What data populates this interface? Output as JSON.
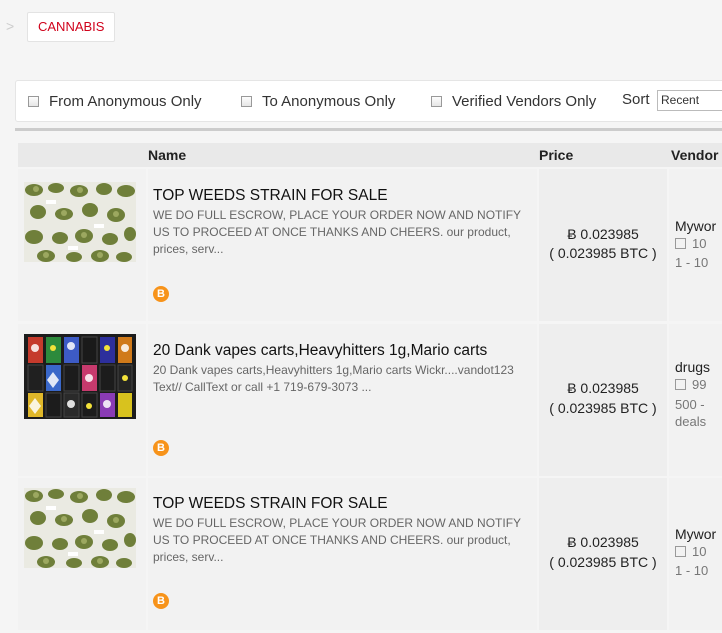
{
  "breadcrumb": {
    "separator": ">",
    "category": "CANNABIS"
  },
  "filters": {
    "from_anonymous": "From Anonymous Only",
    "to_anonymous": "To Anonymous Only",
    "verified_vendors": "Verified Vendors Only",
    "sort_label": "Sort",
    "sort_value": "Recent"
  },
  "table": {
    "headers": {
      "name": "Name",
      "price": "Price",
      "vendor": "Vendor"
    },
    "rows": [
      {
        "title": "TOP WEEDS STRAIN FOR SALE",
        "desc": "WE DO FULL ESCROW, PLACE YOUR ORDER NOW AND NOTIFY US TO PROCEED AT ONCE THANKS AND CHEERS. our product, prices, serv...",
        "price": "Ƀ 0.023985",
        "price_btc": "( 0.023985 BTC )",
        "vendor": "Mywor",
        "vendor_rating": "10",
        "vendor_extra": "1 - 10",
        "vendor_extra2": "",
        "thumb": "buds"
      },
      {
        "title": "20 Dank vapes carts,Heavyhitters 1g,Mario carts",
        "desc": "20 Dank vapes carts,Heavyhitters 1g,Mario carts Wickr....vandot123 Text// CallText or call +1 719-679-3073 ...",
        "price": "Ƀ 0.023985",
        "price_btc": "( 0.023985 BTC )",
        "vendor": "drugs",
        "vendor_rating": "99",
        "vendor_extra": "500 -",
        "vendor_extra2": "deals",
        "thumb": "carts"
      },
      {
        "title": "TOP WEEDS STRAIN FOR SALE",
        "desc": "WE DO FULL ESCROW, PLACE YOUR ORDER NOW AND NOTIFY US TO PROCEED AT ONCE THANKS AND CHEERS. our product, prices, serv...",
        "price": "Ƀ 0.023985",
        "price_btc": "( 0.023985 BTC )",
        "vendor": "Mywor",
        "vendor_rating": "10",
        "vendor_extra": "1 - 10",
        "vendor_extra2": "",
        "thumb": "buds"
      }
    ]
  },
  "icons": {
    "bitcoin": "bitcoin-icon",
    "checkbox": "checkbox-icon"
  },
  "colors": {
    "category": "#d0021b",
    "bitcoin": "#f7931a"
  }
}
